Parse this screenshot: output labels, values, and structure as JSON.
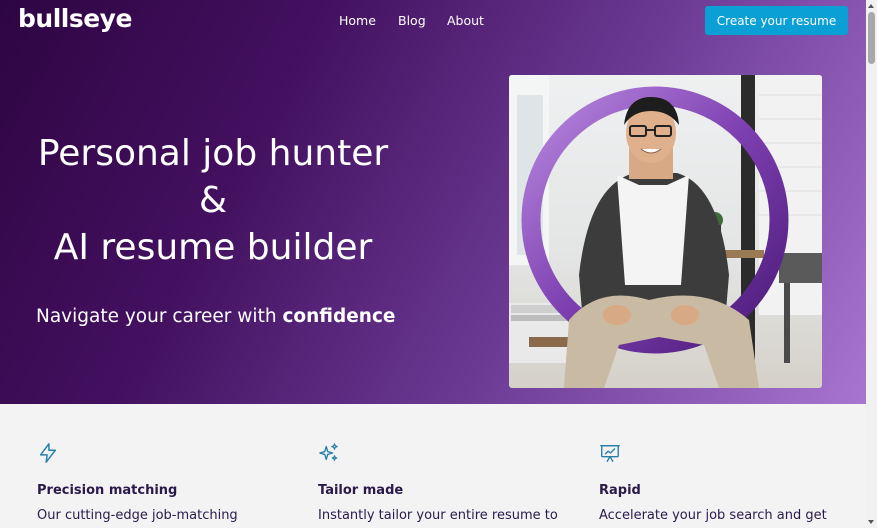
{
  "header": {
    "logo": "bullseye",
    "nav": [
      "Home",
      "Blog",
      "About"
    ],
    "cta": "Create your resume"
  },
  "hero": {
    "headline_lines": [
      "Personal job hunter",
      "&",
      "AI resume builder"
    ],
    "subline_prefix": "Navigate your career with ",
    "subline_emphasis": "confidence"
  },
  "features": [
    {
      "icon": "bolt-icon",
      "title": "Precision matching",
      "desc": "Our cutting-edge job-matching"
    },
    {
      "icon": "sparkles-icon",
      "title": "Tailor made",
      "desc": "Instantly tailor your entire resume to"
    },
    {
      "icon": "presentation-chart-icon",
      "title": "Rapid",
      "desc": "Accelerate your job search and get"
    }
  ],
  "colors": {
    "accent": "#0aa0d6",
    "hero_dark": "#2e0543",
    "hero_light": "#a875d1",
    "icon": "#2a7fa8",
    "text_dark": "#2a1a4a"
  }
}
